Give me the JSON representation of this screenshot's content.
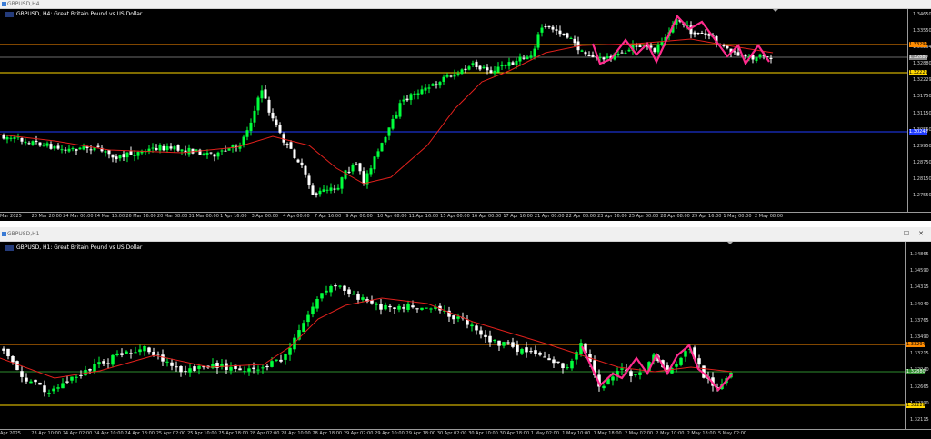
{
  "colors": {
    "background": "#000000",
    "candle_up": "#00ff3c",
    "candle_down": "#ffffff",
    "ma_line": "#e0201c",
    "zigzag": "#ff2b8d",
    "resistance_line": "#ff8c00",
    "support_line": "#ffd700",
    "blue_line": "#1f3bff",
    "green_line": "#2e8b2e"
  },
  "top_chart": {
    "window_title": "GBPUSD,H4",
    "symbol_label": "GBPUSD, H4:  Great Britain Pound vs US Dollar",
    "price_labels": [
      "1.34650",
      "1.33550",
      "1.33294",
      "1.32880",
      "1.32229",
      "1.31750",
      "1.31150",
      "1.30550",
      "1.29950",
      "1.28750",
      "1.28150",
      "1.27550"
    ],
    "tags": {
      "orange": "1.33294",
      "current": "1.32880",
      "yellow": "1.32229",
      "blue": "1.30248"
    },
    "time_labels": [
      "Mar 2025",
      "20 Mar 20:00",
      "24 Mar 00:00",
      "24 Mar 16:00",
      "26 Mar 16:00",
      "20 Mar 08:00",
      "31 Mar 00:00",
      "1 Apr 16:00",
      "3 Apr 00:00",
      "4 Apr 00:00",
      "7 Apr 16:00",
      "9 Apr 00:00",
      "10 Apr 08:00",
      "11 Apr 16:00",
      "15 Apr 00:00",
      "16 Apr 00:00",
      "17 Apr 16:00",
      "21 Apr 00:00",
      "22 Apr 08:00",
      "23 Apr 16:00",
      "25 Apr 00:00",
      "28 Apr 08:00",
      "29 Apr 16:00",
      "1 May 00:00",
      "2 May 08:00"
    ]
  },
  "bottom_chart": {
    "window_title": "GBPUSD,H1",
    "symbol_label": "GBPUSD, H1:  Great Britain Pound vs US Dollar",
    "price_labels": [
      "1.34865",
      "1.34590",
      "1.34315",
      "1.34040",
      "1.33765",
      "1.33490",
      "1.33215",
      "1.32940",
      "1.32665",
      "1.32390",
      "1.32115"
    ],
    "tags": {
      "orange": "1.33294",
      "current": "1.32880",
      "yellow": "1.32229"
    },
    "time_labels": [
      "Apr 2025",
      "23 Apr 10:00",
      "24 Apr 02:00",
      "24 Apr 10:00",
      "24 Apr 18:00",
      "25 Apr 02:00",
      "25 Apr 10:00",
      "25 Apr 18:00",
      "28 Apr 02:00",
      "28 Apr 10:00",
      "28 Apr 18:00",
      "29 Apr 02:00",
      "29 Apr 10:00",
      "29 Apr 18:00",
      "30 Apr 02:00",
      "30 Apr 10:00",
      "30 Apr 18:00",
      "1 May 02:00",
      "1 May 10:00",
      "1 May 18:00",
      "2 May 02:00",
      "2 May 10:00",
      "2 May 18:00",
      "5 May 02:00"
    ]
  }
}
